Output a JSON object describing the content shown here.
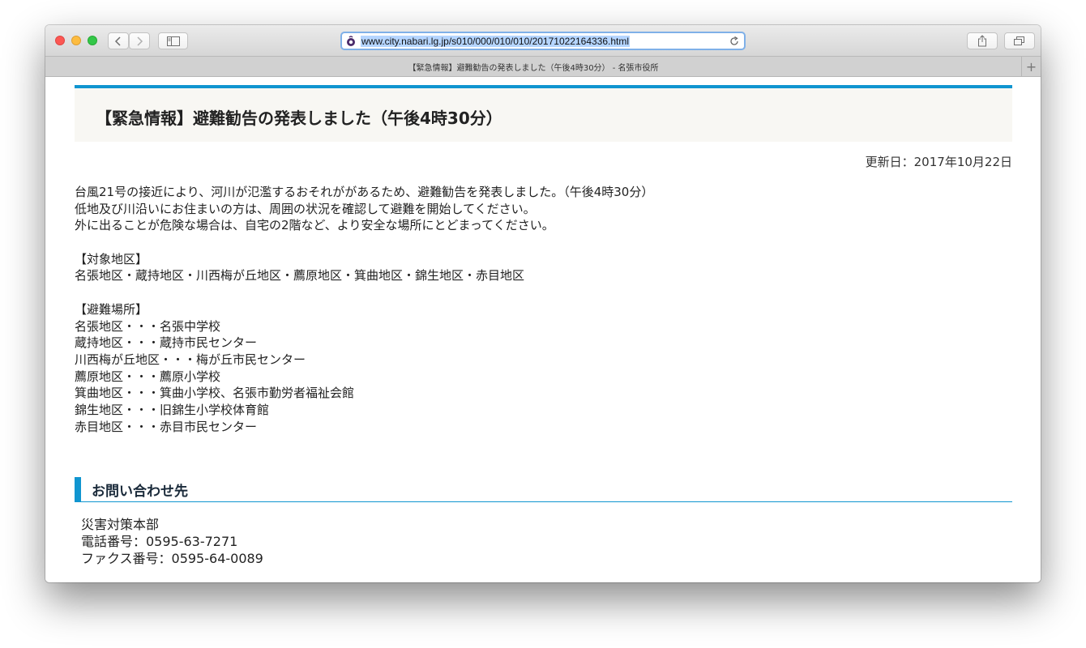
{
  "browser": {
    "url": "www.city.nabari.lg.jp/s010/000/010/010/20171022164336.html",
    "tab_title": "【緊急情報】避難勧告の発表しました（午後4時30分） - 名張市役所",
    "icons": [
      "close-window",
      "minimize-window",
      "zoom-window",
      "back",
      "forward",
      "sidebar",
      "site-favicon",
      "reload",
      "share",
      "tabs-overview",
      "new-tab"
    ],
    "new_tab_glyph": "+"
  },
  "article": {
    "title": "【緊急情報】避難勧告の発表しました（午後4時30分）",
    "updated": "更新日：2017年10月22日",
    "lines": [
      "台風21号の接近により、河川が氾濫するおそれががあるため、避難勧告を発表しました。（午後4時30分）",
      "低地及び川沿いにお住まいの方は、周囲の状況を確認して避難を開始してください。",
      "外に出ることが危険な場合は、自宅の2階など、より安全な場所にとどまってください。",
      "",
      "【対象地区】",
      "名張地区・蔵持地区・川西梅が丘地区・薦原地区・箕曲地区・錦生地区・赤目地区",
      "",
      "【避難場所】",
      "名張地区・・・名張中学校",
      "蔵持地区・・・蔵持市民センター",
      "川西梅が丘地区・・・梅が丘市民センター",
      "薦原地区・・・薦原小学校",
      "箕曲地区・・・箕曲小学校、名張市勤労者福祉会館",
      "錦生地区・・・旧錦生小学校体育館",
      "赤目地区・・・赤目市民センター"
    ]
  },
  "contact": {
    "heading": "お問い合わせ先",
    "dept": "災害対策本部",
    "phone": "電話番号：0595-63-7271",
    "fax": "ファクス番号：0595-64-0089"
  },
  "colors": {
    "accent": "#1095d0",
    "heading_bg": "#f8f7f3",
    "url_selection": "#b5d5ff"
  }
}
